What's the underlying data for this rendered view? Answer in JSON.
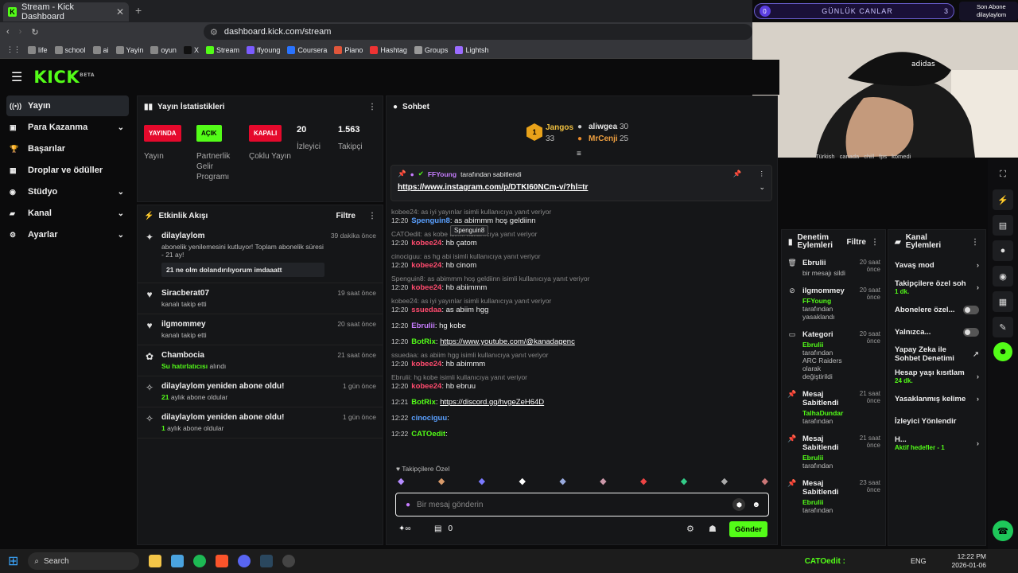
{
  "browser": {
    "tab_title": "Stream - Kick Dashboard",
    "url": "dashboard.kick.com/stream",
    "bookmarks": [
      "life",
      "school",
      "ai",
      "Yayin",
      "oyun",
      "X",
      "Stream",
      "ffyoung",
      "Coursera",
      "Piano",
      "Hashtag",
      "Groups",
      "Lightsh"
    ]
  },
  "overlay": {
    "goal_count": "0",
    "goal_label": "GÜNLÜK CANLAR",
    "goal_target": "3",
    "sub_title": "Son Abone",
    "sub_name": "dilaylaylom",
    "tags": [
      "Türkish",
      "canada",
      "chill",
      "fps",
      "komedi"
    ]
  },
  "nav": {
    "items": [
      {
        "label": "Yayın",
        "icon": "broadcast-icon",
        "active": true
      },
      {
        "label": "Para Kazanma",
        "icon": "money-icon",
        "chevron": true
      },
      {
        "label": "Başarılar",
        "icon": "trophy-icon"
      },
      {
        "label": "Droplar ve ödüller",
        "icon": "gift-icon"
      },
      {
        "label": "Stüdyo",
        "icon": "studio-icon",
        "chevron": true
      },
      {
        "label": "Kanal",
        "icon": "channel-icon",
        "chevron": true
      },
      {
        "label": "Ayarlar",
        "icon": "gear-icon",
        "chevron": true
      }
    ]
  },
  "stats": {
    "title": "Yayın İstatistikleri",
    "badges": [
      {
        "text": "YAYINDA",
        "label": "Yayın",
        "bg": "#e5092c",
        "fg": "#ffffff"
      },
      {
        "text": "AÇIK",
        "label": "Partnerlik Gelir Programı",
        "bg": "#53fc18",
        "fg": "#000000"
      },
      {
        "text": "KAPALI",
        "label": "Çoklu Yayın",
        "bg": "#e5092c",
        "fg": "#ffffff"
      }
    ],
    "viewers_value": "20",
    "viewers_label": "İzleyici",
    "followers_value": "1.563",
    "followers_label": "Takipçi"
  },
  "activity": {
    "title": "Etkinlik Akışı",
    "filter": "Filtre",
    "items": [
      {
        "name": "dilaylaylom",
        "sub": "abonelik yenilemesini kutluyor! Toplam abonelik süresi - 21 ay!",
        "msg": "21 ne olm dolandırılıyorum imdaaatt",
        "time": "39 dakika önce",
        "icon": "star-icon"
      },
      {
        "name": "Siracberat07",
        "sub": "kanalı takip etti",
        "time": "19 saat önce",
        "icon": "heart-icon"
      },
      {
        "name": "ilgmommey",
        "sub": "kanalı takip etti",
        "time": "20 saat önce",
        "icon": "heart-icon"
      },
      {
        "name": "Chambocia",
        "sub_green": "Su hatırlatıcısı",
        "sub": "alındı",
        "time": "21 saat önce",
        "icon": "reward-icon"
      },
      {
        "name": "dilaylaylom yeniden abone oldu!",
        "sub_green": "21",
        "sub": "aylık abone oldular",
        "time": "1 gün önce",
        "icon": "sparkle-icon"
      },
      {
        "name": "dilaylaylom yeniden abone oldu!",
        "sub_green": "1",
        "sub": "aylık abone oldular",
        "time": "1 gün önce",
        "icon": "sparkle-icon"
      }
    ]
  },
  "chat": {
    "title": "Sohbet",
    "leaders": [
      {
        "rank": "1",
        "name": "Jangos",
        "count": "33"
      },
      {
        "name": "aliwgea",
        "count": "30"
      },
      {
        "name": "MrCenji",
        "count": "25"
      }
    ],
    "pinned_by_name": "FFYoung",
    "pinned_by_text": "tarafından sabitlendi",
    "pinned_link": "https://www.instagram.com/p/DTKI60NCm-v/?hl=tr",
    "tooltip": "Spenguin8",
    "messages": [
      {
        "reply": "kobee24: as iyi yayınlar isimli kullanıcıya yanıt veriyor",
        "time": "12:20",
        "user": "Spenguin8",
        "text": ": as abimmm hoş geldiinn",
        "color": "#5aa0ff"
      },
      {
        "reply": "CATOedit: as kobe isimli kullanıcıya yanıt veriyor",
        "time": "12:20",
        "user": "kobee24",
        "text": ": hb çatom",
        "color": "#ff4b6e"
      },
      {
        "reply": "cinociguu: as hg abi isimli kullanıcıya yanıt veriyor",
        "time": "12:20",
        "user": "kobee24",
        "text": ": hb cinom",
        "color": "#ff4b6e"
      },
      {
        "reply": "Spenguin8: as abimmm hoş geldiinn isimli kullanıcıya yanıt veriyor",
        "time": "12:20",
        "user": "kobee24",
        "text": ": hb abiimmm",
        "color": "#ff4b6e"
      },
      {
        "reply": "kobee24: as iyi yayınlar isimli kullanıcıya yanıt veriyor",
        "time": "12:20",
        "user": "ssuedaa",
        "text": ": as abiim hgg",
        "color": "#ff4b6e"
      },
      {
        "time": "12:20",
        "user": "Ebrulii",
        "text": ": hg kobe",
        "color": "#c77dff"
      },
      {
        "time": "12:20",
        "user": "BotRix",
        "text": ": ",
        "link": "https://www.youtube.com/@kanadagenc",
        "color": "#53fc18"
      },
      {
        "reply": "ssuedaa: as abiim hgg isimli kullanıcıya yanıt veriyor",
        "time": "12:20",
        "user": "kobee24",
        "text": ": hb abimmm",
        "color": "#ff4b6e"
      },
      {
        "reply": "Ebrulii: hg kobe isimli kullanıcıya yanıt veriyor",
        "time": "12:20",
        "user": "kobee24",
        "text": ": hb ebruu",
        "color": "#ff4b6e"
      },
      {
        "time": "12:21",
        "user": "BotRix",
        "text": ": ",
        "link": "https://discord.gg/hvgeZeH64D",
        "color": "#53fc18"
      },
      {
        "time": "12:22",
        "user": "cinociguu",
        "text": ": ",
        "color": "#5aa0ff"
      },
      {
        "time": "12:22",
        "user": "CATOedit",
        "text": ": ",
        "color": "#53fc18"
      }
    ],
    "followers_only": "Takipçilere Özel",
    "input_placeholder": "Bir mesaj gönderin",
    "points": "0",
    "send": "Gönder"
  },
  "mod": {
    "title": "Denetim Eylemleri",
    "filter": "Filtre",
    "items": [
      {
        "name": "Ebrulii",
        "sub": "bir mesajı sildi",
        "time": "20 saat önce",
        "icon": "trash-icon"
      },
      {
        "name": "ilgmommey",
        "sub_green": "FFYoung",
        "sub": "tarafından yasaklandı",
        "time": "20 saat önce",
        "icon": "ban-icon"
      },
      {
        "name": "Kategori",
        "sub_green": "Ebrulii",
        "sub": "tarafından ARC Raiders olarak değiştirildi",
        "time": "20 saat önce",
        "icon": "category-icon"
      },
      {
        "name": "Mesaj Sabitlendi",
        "sub_green": "TalhaDundar",
        "sub": "tarafından",
        "time": "21 saat önce",
        "icon": "pin-icon"
      },
      {
        "name": "Mesaj Sabitlendi",
        "sub_green": "Ebrulii",
        "sub": "tarafından",
        "time": "21 saat önce",
        "icon": "pin-icon"
      },
      {
        "name": "Mesaj Sabitlendi",
        "sub_green": "Ebrulii",
        "sub": "tarafından",
        "time": "23 saat önce",
        "icon": "pin-icon"
      }
    ]
  },
  "channel": {
    "title": "Kanal Eylemleri",
    "items": [
      {
        "label": "Yavaş mod",
        "type": "arrow"
      },
      {
        "label": "Takipçilere özel soh",
        "sub": "1 dk.",
        "type": "arrow"
      },
      {
        "label": "Abonelere özel...",
        "type": "toggle"
      },
      {
        "label": "Yalnızca...",
        "type": "toggle"
      },
      {
        "label": "Yapay Zeka ile Sohbet Denetimi",
        "type": "ext"
      },
      {
        "label": "Hesap yaşı kısıtlam",
        "sub": "24 dk.",
        "type": "arrow"
      },
      {
        "label": "Yasaklanmış kelime",
        "type": "arrow"
      },
      {
        "label": "İzleyici Yönlendir",
        "type": "none"
      },
      {
        "label": "H...",
        "sub": "Aktif hedefler - 1",
        "type": "arrow"
      }
    ]
  },
  "taskbar": {
    "search": "Search",
    "tray_user": "CATOedit :",
    "lang": "ENG",
    "time": "12:22 PM",
    "date": "2026-01-06"
  }
}
